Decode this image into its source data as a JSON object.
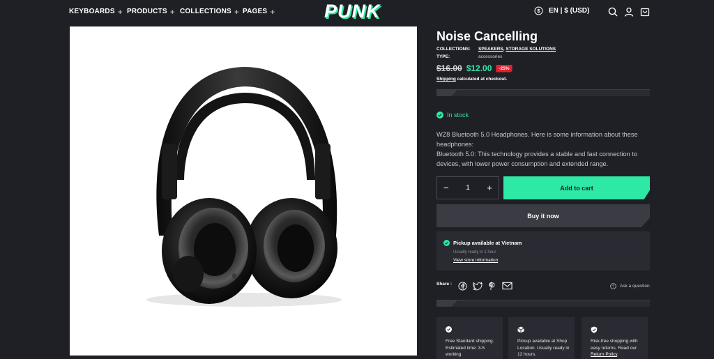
{
  "header": {
    "nav": [
      "KEYBOARDS",
      "PRODUCTS",
      "COLLECTIONS",
      "PAGES"
    ],
    "logo_text": "PUNK",
    "locale": "EN | $ (USD)",
    "icons": [
      "currency-icon",
      "search-icon",
      "account-icon",
      "cart-icon"
    ]
  },
  "product": {
    "title": "Noise Cancelling",
    "collections_label": "COLLECTIONS:",
    "collections": [
      "SPEAKERS",
      "STORAGE SOLUTIONS"
    ],
    "collections_sep": ",",
    "type_label": "TYPE:",
    "type_value": "accessories",
    "price_old": "$16.00",
    "price_new": "$12.00",
    "discount_badge": "-25%",
    "shipping_link": "Shipping",
    "shipping_text": " calculated at checkout.",
    "stock_status": "In stock",
    "description_1": "WZ8 Bluetooth 5.0 Headphones. Here is some information about these headphones:",
    "description_2": "Bluetooth 5.0: This technology provides a stable and fast connection to devices, with lower power consumption and extended range.",
    "quantity": "1",
    "qty_minus": "−",
    "qty_plus": "+",
    "add_to_cart": "Add to cart",
    "buy_now": "Buy it now"
  },
  "pickup": {
    "title": "Pickup available at Vietnam",
    "subtitle": "Usually ready in 1 hour",
    "link": "View store information"
  },
  "share": {
    "label": "Share :",
    "icons": [
      "facebook-icon",
      "twitter-icon",
      "pinterest-icon",
      "email-icon"
    ],
    "ask": "Ask a question"
  },
  "features": [
    {
      "icon": "check-circle-icon",
      "text": "Free Standard shipping. Estimated time: 3-5 working"
    },
    {
      "icon": "box-icon",
      "text": "Pickup available at Shop Location. Usually ready in 12 hours."
    },
    {
      "icon": "shield-icon",
      "text_before": "Risk-free shopping with easy returns. Read our ",
      "link": "Return Policy",
      "text_after": "."
    }
  ],
  "colors": {
    "background": "#1f2026",
    "accent": "#2ee8a5",
    "badge": "#e5202f",
    "panel": "#2a2b32"
  }
}
